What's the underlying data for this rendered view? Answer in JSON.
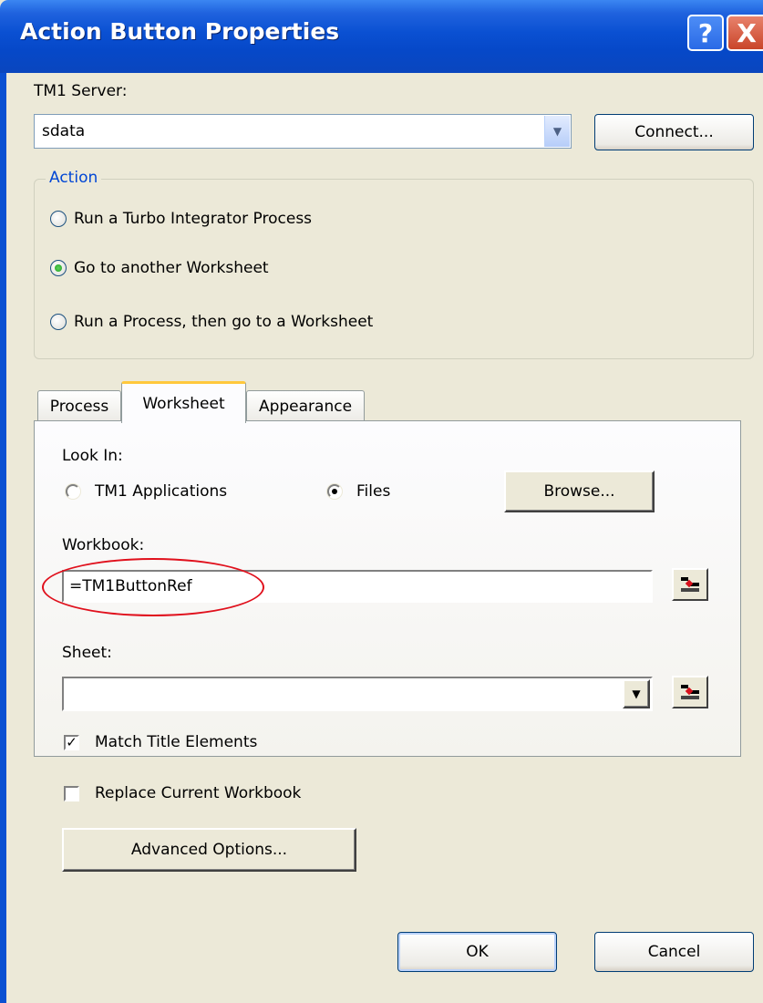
{
  "window": {
    "title": "Action Button Properties",
    "help_glyph": "?",
    "close_glyph": "X"
  },
  "server": {
    "label": "TM1 Server:",
    "value": "sdata",
    "connect_label": "Connect..."
  },
  "action": {
    "legend": "Action",
    "options": [
      {
        "label": "Run a Turbo Integrator Process",
        "selected": false
      },
      {
        "label": "Go to another Worksheet",
        "selected": true
      },
      {
        "label": "Run a Process, then go to a Worksheet",
        "selected": false
      }
    ]
  },
  "tabs": [
    {
      "label": "Process",
      "active": false
    },
    {
      "label": "Worksheet",
      "active": true
    },
    {
      "label": "Appearance",
      "active": false
    }
  ],
  "worksheet": {
    "look_in_label": "Look In:",
    "look_in_options": [
      {
        "label": "TM1 Applications",
        "selected": false
      },
      {
        "label": "Files",
        "selected": true
      }
    ],
    "browse_label": "Browse...",
    "workbook_label": "Workbook:",
    "workbook_value": "=TM1ButtonRef",
    "sheet_label": "Sheet:",
    "sheet_value": "",
    "match_title_label": "Match Title Elements",
    "match_title_checked": true,
    "replace_label": "Replace Current Workbook",
    "replace_checked": false,
    "advanced_label": "Advanced Options..."
  },
  "footer": {
    "ok_label": "OK",
    "cancel_label": "Cancel"
  },
  "icons": [
    "help-icon",
    "close-icon",
    "chevron-down-icon",
    "cell-reference-icon"
  ],
  "colors": {
    "titlebar": "#0a50d2",
    "dialog_bg": "#ece9d8",
    "legend_text": "#0046d5",
    "annotation_oval": "#e0101c",
    "active_tab_accent": "#ffc83c"
  }
}
